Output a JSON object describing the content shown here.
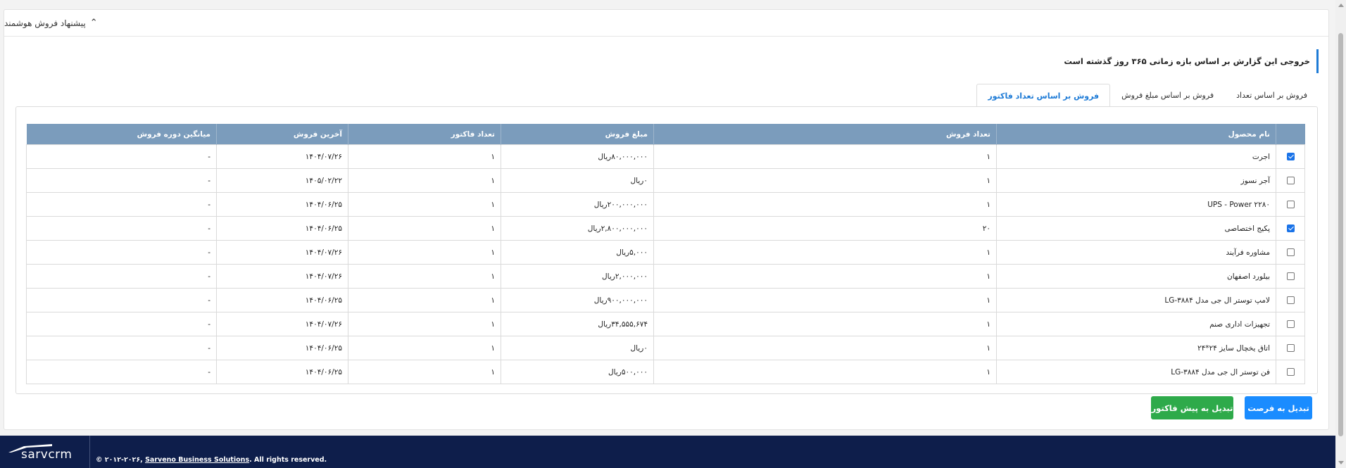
{
  "panel": {
    "title": "پیشنهاد فروش هوشمند"
  },
  "info": {
    "text": "خروجی این گزارش بر اساس بازه زمانی ۳۶۵ روز گذشته است"
  },
  "tabs": [
    {
      "label": "فروش بر اساس تعداد",
      "active": false
    },
    {
      "label": "فروش بر اساس مبلغ فروش",
      "active": false
    },
    {
      "label": "فروش بر اساس تعداد فاکتور",
      "active": true
    }
  ],
  "table": {
    "headers": [
      "نام محصول",
      "تعداد فروش",
      "مبلغ فروش",
      "تعداد فاکتور",
      "آخرین فروش",
      "میانگین دوره فروش"
    ],
    "rows": [
      {
        "checked": true,
        "cells": [
          "اجرت",
          "۱",
          "۸۰,۰۰۰,۰۰۰ریال",
          "۱",
          "۱۴۰۴/۰۷/۲۶",
          "-"
        ]
      },
      {
        "checked": false,
        "cells": [
          "آجر نسوز",
          "۱",
          "۰ریال",
          "۱",
          "۱۴۰۵/۰۲/۲۲",
          "-"
        ]
      },
      {
        "checked": false,
        "cells": [
          "UPS - Power ۲۲۸۰",
          "۱",
          "۲۰۰,۰۰۰,۰۰۰ریال",
          "۱",
          "۱۴۰۴/۰۶/۲۵",
          "-"
        ]
      },
      {
        "checked": true,
        "cells": [
          "پکیج اختصاصی",
          "۲۰",
          "۲,۸۰۰,۰۰۰,۰۰۰ریال",
          "۱",
          "۱۴۰۴/۰۶/۲۵",
          "-"
        ]
      },
      {
        "checked": false,
        "cells": [
          "مشاوره فرآیند",
          "۱",
          "۵,۰۰۰ریال",
          "۱",
          "۱۴۰۴/۰۷/۲۶",
          "-"
        ]
      },
      {
        "checked": false,
        "cells": [
          "بیلورد اصفهان",
          "۱",
          "۲,۰۰۰,۰۰۰ریال",
          "۱",
          "۱۴۰۴/۰۷/۲۶",
          "-"
        ]
      },
      {
        "checked": false,
        "cells": [
          "لامپ توستر ال جی مدل LG-۳۸۸۴",
          "۱",
          "۹۰۰,۰۰۰,۰۰۰ریال",
          "۱",
          "۱۴۰۴/۰۶/۲۵",
          "-"
        ]
      },
      {
        "checked": false,
        "cells": [
          "تجهیزات اداری صنم",
          "۱",
          "۳۴,۵۵۵,۶۷۴ریال",
          "۱",
          "۱۴۰۴/۰۷/۲۶",
          "-"
        ]
      },
      {
        "checked": false,
        "cells": [
          "اتاق یخچال سایز ۲۴*۲۴",
          "۱",
          "۰ریال",
          "۱",
          "۱۴۰۴/۰۶/۲۵",
          "-"
        ]
      },
      {
        "checked": false,
        "cells": [
          "فن توستر ال جی مدل LG-۳۸۸۴",
          "۱",
          "۵۰۰,۰۰۰ریال",
          "۱",
          "۱۴۰۴/۰۶/۲۵",
          "-"
        ]
      }
    ]
  },
  "buttons": {
    "opportunity": "تبدیل به فرصت",
    "proforma": "تبدیل به پیش فاکتور"
  },
  "footer": {
    "logo": "sarvcrm",
    "copyright_prefix": "© ۲۰۱۲-۲۰۲۶, ",
    "company": "Sarveno Business Solutions",
    "copyright_suffix": ". All rights reserved."
  },
  "icons": {
    "collapse": "chevron-up-icon",
    "logo_mark": "sarv-logo-icon"
  },
  "colors": {
    "accent": "#1a8cff",
    "success": "#2eaa4a",
    "table_header": "#7b9cbc",
    "footer": "#0e1e4b"
  }
}
